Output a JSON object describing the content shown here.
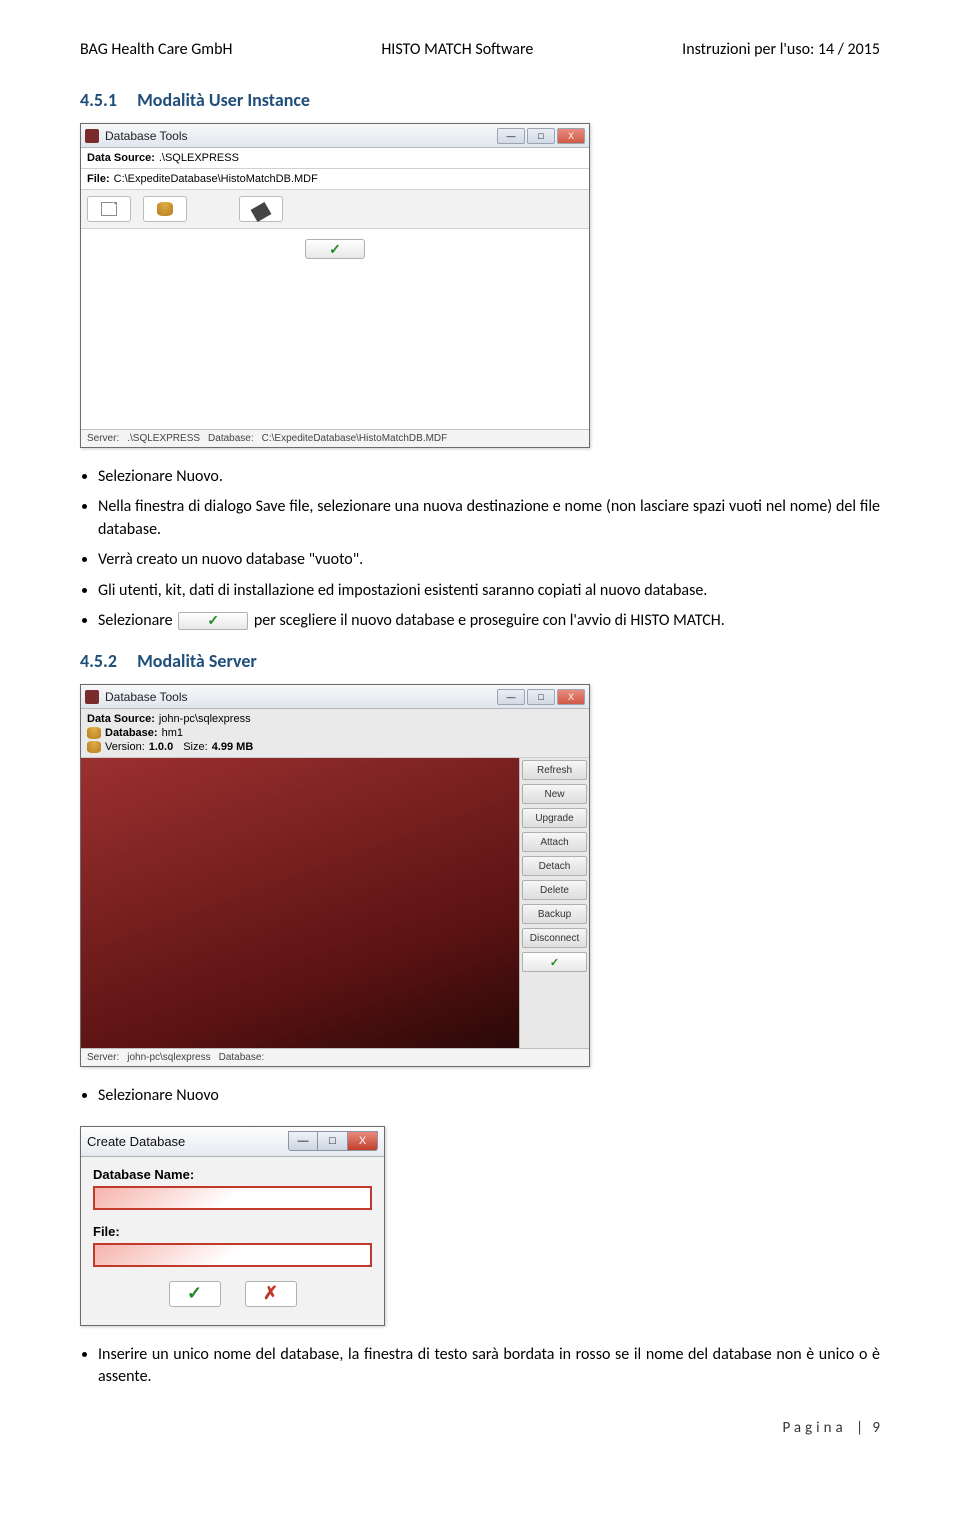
{
  "header": {
    "left": "BAG Health Care GmbH",
    "center": "HISTO MATCH Software",
    "right": "Instruzioni per l'uso: 14 / 2015"
  },
  "section1": {
    "number": "4.5.1",
    "title": "Modalità User Instance"
  },
  "win1": {
    "title": "Database Tools",
    "data_source_label": "Data Source:",
    "data_source_value": ".\\SQLEXPRESS",
    "file_label": "File:",
    "file_value": "C:\\ExpediteDatabase\\HistoMatchDB.MDF",
    "check_glyph": "✓",
    "status_server_label": "Server:",
    "status_server_value": ".\\SQLEXPRESS",
    "status_db_label": "Database:",
    "status_db_value": "C:\\ExpediteDatabase\\HistoMatchDB.MDF"
  },
  "bullets1": {
    "b1": "Selezionare Nuovo.",
    "b2": "Nella finestra di dialogo Save file,  selezionare una nuova destinazione e nome (non lasciare spazi vuoti nel nome) del file database.",
    "b3": "Verrà creato un nuovo database \"vuoto\".",
    "b4": "Gli utenti, kit, dati di installazione ed impostazioni esistenti saranno copiati al nuovo database.",
    "b5a": "Selezionare",
    "b5b": "per scegliere il nuovo database e proseguire con l'avvio di HISTO MATCH.",
    "b5_glyph": "✓"
  },
  "section2": {
    "number": "4.5.2",
    "title": "Modalità Server"
  },
  "win2": {
    "title": "Database Tools",
    "data_source_label": "Data Source:",
    "data_source_value": "john-pc\\sqlexpress",
    "db_label": "Database:",
    "db_value": "hm1",
    "version_label": "Version:",
    "version_value": "1.0.0",
    "size_label": "Size:",
    "size_value": "4.99 MB",
    "side_buttons": [
      "Refresh",
      "New",
      "Upgrade",
      "Attach",
      "Detach",
      "Delete",
      "Backup",
      "Disconnect"
    ],
    "check_glyph": "✓",
    "status_server_label": "Server:",
    "status_server_value": "john-pc\\sqlexpress",
    "status_db_label": "Database:"
  },
  "bullets2": {
    "b1": "Selezionare Nuovo"
  },
  "win3": {
    "title": "Create Database",
    "dbname_label": "Database Name:",
    "file_label": "File:",
    "ok_glyph": "✓",
    "cancel_glyph": "✗",
    "min_glyph": "—",
    "max_glyph": "□",
    "close_glyph": "X"
  },
  "bullets3": {
    "b1": "Inserire un unico nome del database, la finestra di testo sarà bordata in rosso se il nome del database non è unico o è assente."
  },
  "footer": {
    "label": "Pagina",
    "sep": " | ",
    "num": "9"
  }
}
